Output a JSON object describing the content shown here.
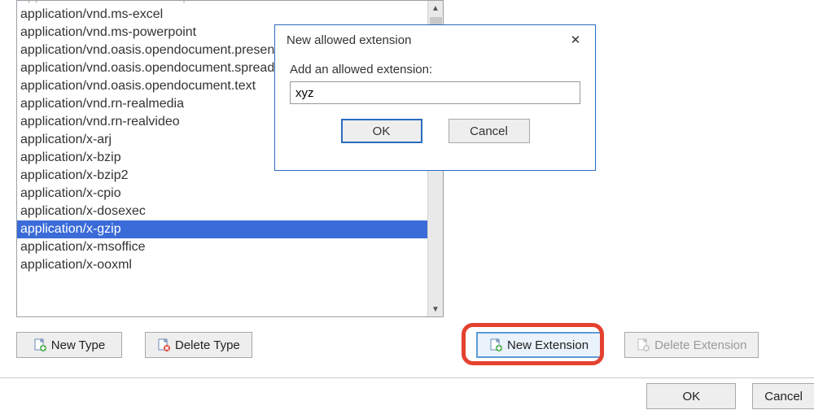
{
  "mimeTypes": {
    "items": [
      "application/vnd.ms-cab-compressed",
      "application/vnd.ms-excel",
      "application/vnd.ms-powerpoint",
      "application/vnd.oasis.opendocument.presentation",
      "application/vnd.oasis.opendocument.spreadsheet",
      "application/vnd.oasis.opendocument.text",
      "application/vnd.rn-realmedia",
      "application/vnd.rn-realvideo",
      "application/x-arj",
      "application/x-bzip",
      "application/x-bzip2",
      "application/x-cpio",
      "application/x-dosexec",
      "application/x-gzip",
      "application/x-msoffice",
      "application/x-ooxml"
    ],
    "selectedIndex": 13
  },
  "buttons": {
    "newType": "New Type",
    "deleteType": "Delete Type",
    "newExtension": "New Extension",
    "deleteExtension": "Delete Extension",
    "ok": "OK",
    "cancel": "Cancel"
  },
  "dialog": {
    "title": "New allowed extension",
    "label": "Add an allowed extension:",
    "value": "xyz",
    "ok": "OK",
    "cancel": "Cancel"
  }
}
